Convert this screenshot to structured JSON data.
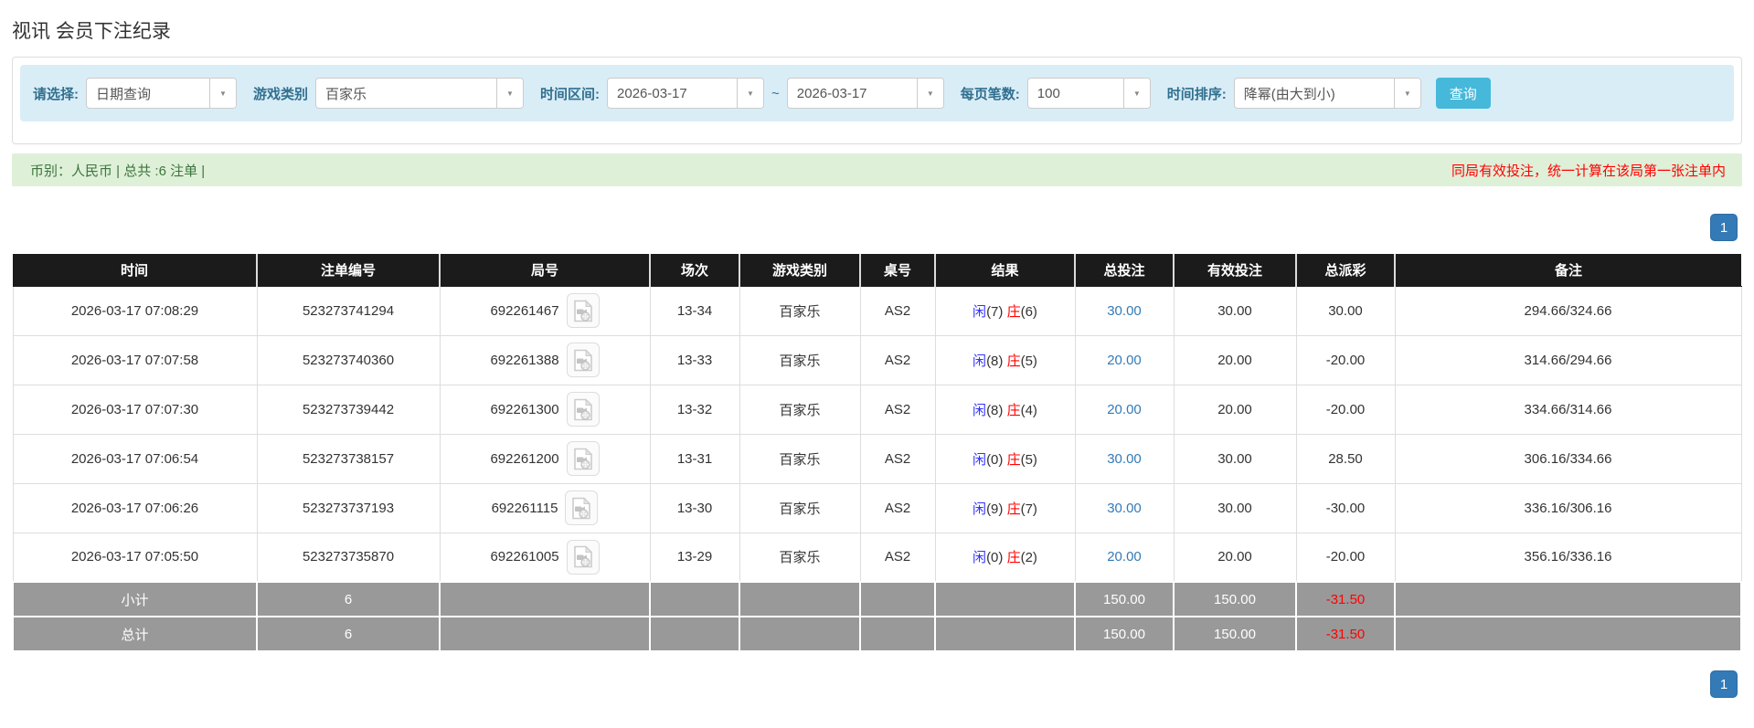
{
  "page": {
    "title": "视讯 会员下注纪录"
  },
  "filters": {
    "select_label": "请选择:",
    "select_value": "日期查询",
    "game_label": "游戏类别",
    "game_value": "百家乐",
    "range_label": "时间区间:",
    "date_from": "2026-03-17",
    "range_separator": "~",
    "date_to": "2026-03-17",
    "per_page_label": "每页笔数:",
    "per_page_value": "100",
    "sort_label": "时间排序:",
    "sort_value": "降幂(由大到小)",
    "search_button": "查询",
    "caret": "▼"
  },
  "summary_bar": {
    "left": "币别：人民币 | 总共 :6 注单 |",
    "right": "同局有效投注，统一计算在该局第一张注单内"
  },
  "pagination": {
    "page": "1"
  },
  "colors": {
    "accent_blue": "#337ab7",
    "filter_bg": "#d9edf7",
    "success_bg": "#dff0d8",
    "highlight_yellow": "#f8f5a3",
    "header_black": "#1b1b1b",
    "summary_gray": "#999999",
    "negative_red": "#ff0000",
    "player_blue": "#3232ff"
  },
  "table": {
    "headers": [
      "时间",
      "注单编号",
      "局号",
      "场次",
      "游戏类别",
      "桌号",
      "结果",
      "总投注",
      "有效投注",
      "总派彩",
      "备注"
    ],
    "rows": [
      {
        "time": "2026-03-17 07:08:29",
        "bet_id": "523273741294",
        "round": "692261467",
        "session": "13-34",
        "game": "百家乐",
        "table_no": "AS2",
        "player_name": "闲",
        "player_score": "(7)",
        "banker_name": "庄",
        "banker_score": "(6)",
        "total_bet": "30.00",
        "valid_bet": "30.00",
        "payout": "30.00",
        "note": "294.66/324.66",
        "highlight": false
      },
      {
        "time": "2026-03-17 07:07:58",
        "bet_id": "523273740360",
        "round": "692261388",
        "session": "13-33",
        "game": "百家乐",
        "table_no": "AS2",
        "player_name": "闲",
        "player_score": "(8)",
        "banker_name": "庄",
        "banker_score": "(5)",
        "total_bet": "20.00",
        "valid_bet": "20.00",
        "payout": "-20.00",
        "note": "314.66/294.66",
        "highlight": false
      },
      {
        "time": "2026-03-17 07:07:30",
        "bet_id": "523273739442",
        "round": "692261300",
        "session": "13-32",
        "game": "百家乐",
        "table_no": "AS2",
        "player_name": "闲",
        "player_score": "(8)",
        "banker_name": "庄",
        "banker_score": "(4)",
        "total_bet": "20.00",
        "valid_bet": "20.00",
        "payout": "-20.00",
        "note": "334.66/314.66",
        "highlight": false
      },
      {
        "time": "2026-03-17 07:06:54",
        "bet_id": "523273738157",
        "round": "692261200",
        "session": "13-31",
        "game": "百家乐",
        "table_no": "AS2",
        "player_name": "闲",
        "player_score": "(0)",
        "banker_name": "庄",
        "banker_score": "(5)",
        "total_bet": "30.00",
        "valid_bet": "30.00",
        "payout": "28.50",
        "note": "306.16/334.66",
        "highlight": false
      },
      {
        "time": "2026-03-17 07:06:26",
        "bet_id": "523273737193",
        "round": "692261115",
        "session": "13-30",
        "game": "百家乐",
        "table_no": "AS2",
        "player_name": "闲",
        "player_score": "(9)",
        "banker_name": "庄",
        "banker_score": "(7)",
        "total_bet": "30.00",
        "valid_bet": "30.00",
        "payout": "-30.00",
        "note": "336.16/306.16",
        "highlight": true
      },
      {
        "time": "2026-03-17 07:05:50",
        "bet_id": "523273735870",
        "round": "692261005",
        "session": "13-29",
        "game": "百家乐",
        "table_no": "AS2",
        "player_name": "闲",
        "player_score": "(0)",
        "banker_name": "庄",
        "banker_score": "(2)",
        "total_bet": "20.00",
        "valid_bet": "20.00",
        "payout": "-20.00",
        "note": "356.16/336.16",
        "highlight": false
      }
    ],
    "subtotal": {
      "label": "小计",
      "count": "6",
      "total_bet": "150.00",
      "valid_bet": "150.00",
      "payout": "-31.50"
    },
    "total": {
      "label": "总计",
      "count": "6",
      "total_bet": "150.00",
      "valid_bet": "150.00",
      "payout": "-31.50"
    }
  }
}
